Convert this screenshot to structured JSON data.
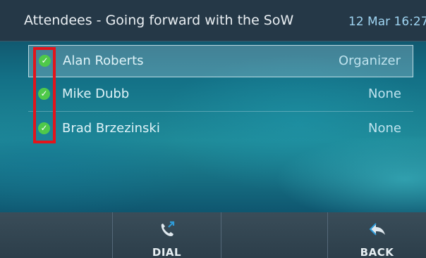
{
  "header": {
    "title": "Attendees - Going forward with the SoW",
    "datetime": "12 Mar 16:27"
  },
  "attendees": [
    {
      "name": "Alan Roberts",
      "role": "Organizer",
      "checked": true,
      "selected": true
    },
    {
      "name": "Mike Dubb",
      "role": "None",
      "checked": true,
      "selected": false
    },
    {
      "name": "Brad Brzezinski",
      "role": "None",
      "checked": true,
      "selected": false
    }
  ],
  "softkeys": {
    "dial": {
      "label": "DIAL",
      "icon": "phone-call-icon"
    },
    "back": {
      "label": "BACK",
      "icon": "back-arrow-icon"
    }
  },
  "annotation": {
    "color": "#e3141b"
  },
  "colors": {
    "check": "#4fc94a",
    "datetime": "#9fd4f1",
    "header_bg": "#253847"
  }
}
